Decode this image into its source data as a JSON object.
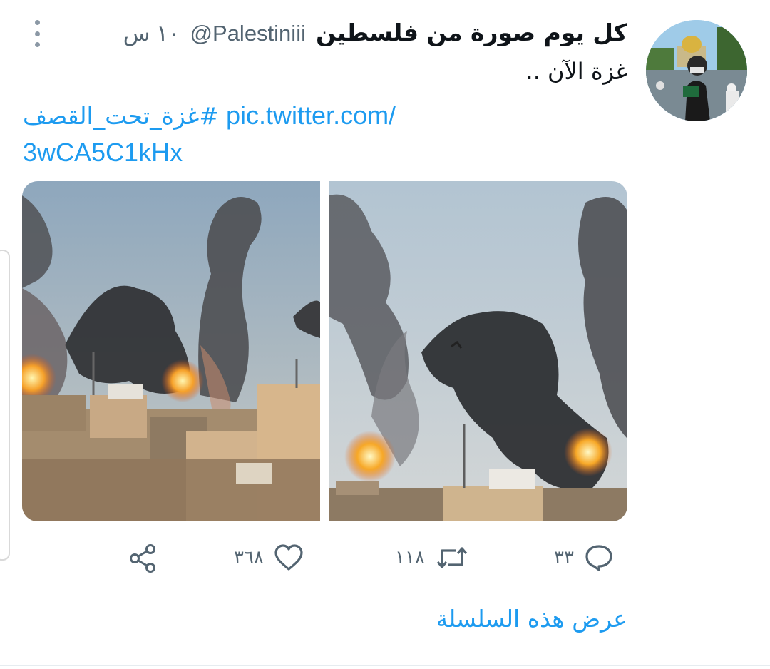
{
  "tweet": {
    "author_name": "كل يوم صورة من فلسطين",
    "handle": "@Palestiniii",
    "time": "١٠ س",
    "text": "غزة الآن ..",
    "hashtag": "#غزة_تحت_القصف",
    "link_part1": "pic.twitter.com/",
    "link_part2": "3wCA5C1kHx",
    "avatar_icon": "profile-photo",
    "media": [
      {
        "icon": "photo-gaza-smoke-left"
      },
      {
        "icon": "photo-gaza-smoke-right"
      }
    ]
  },
  "actions": {
    "reply_count": "٣٣",
    "retweet_count": "١١٨",
    "like_count": "٣٦٨",
    "icons": [
      "reply-icon",
      "retweet-icon",
      "like-icon",
      "share-icon"
    ]
  },
  "show_thread": "عرض هذه السلسلة",
  "colors": {
    "link": "#1d9bf0",
    "secondary_text": "#536471",
    "icon_gray": "#536471"
  }
}
